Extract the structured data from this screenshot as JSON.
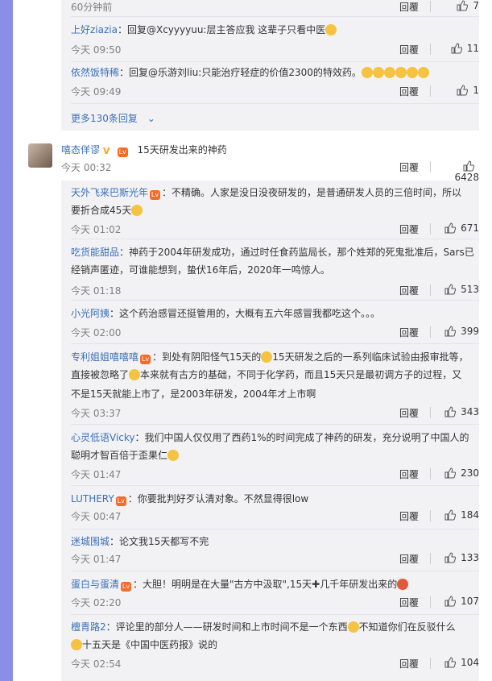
{
  "top_replies": [
    {
      "time": "60分钟前",
      "reply": "回覆",
      "likes": "7"
    },
    {
      "user": "上好ziazia",
      "text": "：回复@Xcyyyyuu:层主答应我 这辈子只看中医",
      "time": "今天 09:50",
      "reply": "回覆",
      "likes": "11"
    },
    {
      "user": "依然饭特稀",
      "text": "：回复@乐游刘liu:只能治疗轻症的价值2300的特效药。",
      "time": "今天 09:49",
      "reply": "回覆",
      "likes": "1"
    }
  ],
  "more_replies": "更多130条回复",
  "main_comment": {
    "user": "嘻态佯谬",
    "text": "15天研发出来的神药",
    "time": "今天 00:32",
    "reply": "回覆",
    "likes": "6428"
  },
  "replies": [
    {
      "user": "天外飞来巴斯光年",
      "line1": "：不精确。人家是没日没夜研发的，是普通研发人员的三倍时间，所以",
      "line2": "要折合成45天",
      "time": "今天 01:02",
      "reply": "回覆",
      "likes": "671"
    },
    {
      "user": "吃货能甜品",
      "line1": "：神药于2004年研发成功，通过时任食药监局长，那个姓郑的死鬼批准后，Sars已",
      "line2": "经销声匿迹，可谁能想到，蛰伏16年后，2020年一鸣惊人。",
      "time": "今天 01:18",
      "reply": "回覆",
      "likes": "513"
    },
    {
      "user": "小光阿姨",
      "line1": "：这个药治感冒还挺管用的，大概有五六年感冒我都吃这个。。。",
      "time": "今天 02:00",
      "reply": "回覆",
      "likes": "399"
    },
    {
      "user": "专利姐姐嘻嘻嘻",
      "line1": "：到处有阴阳怪气15天的",
      "line1b": "15天研发之后的一系列临床试验由报审批等，",
      "line2": "直接被忽略了",
      "line2b": "本来就有古方的基础，不同于化学药，而且15天只是最初调方子的过程，又",
      "line3": "不是15天就能上市了，是2003年研发，2004年才上市啊",
      "time": "今天 03:37",
      "reply": "回覆",
      "likes": "343"
    },
    {
      "user": "心灵低语Vicky",
      "line1": "：我们中国人仅仅用了西药1%的时间完成了神药的研发，充分说明了中国人的",
      "line2": "聪明才智百倍于歪果仁",
      "time": "今天 01:47",
      "reply": "回覆",
      "likes": "230"
    },
    {
      "user": "LUTHERY",
      "line1": "：你要批判好歹认清对象。不然显得很low",
      "time": "今天 00:47",
      "reply": "回覆",
      "likes": "184"
    },
    {
      "user": "迷城围城",
      "line1": "：论文我15天都写不完",
      "time": "今天 01:47",
      "reply": "回覆",
      "likes": "133"
    },
    {
      "user": "蛋白与蛋清",
      "line1": "：大胆！明明是在大量\"古方中汲取\",15天",
      "line1b": "几千年研发出来的",
      "time": "今天 02:20",
      "reply": "回覆",
      "likes": "107"
    },
    {
      "user": "檀青路2",
      "line1": "：评论里的部分人——研发时间和上市时间不是一个东西",
      "line1b": "不知道你们在反驳什么",
      "line2": "十五天是《中国中医药报》说的",
      "time": "今天 02:54",
      "reply": "回覆",
      "likes": "104"
    }
  ]
}
